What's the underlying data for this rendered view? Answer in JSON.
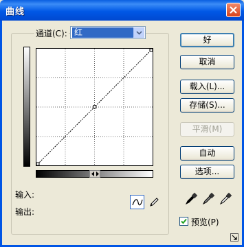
{
  "window": {
    "title": "曲线"
  },
  "channel": {
    "label": "通道(C):",
    "value": "红"
  },
  "curve": {
    "points": [
      [
        0,
        0
      ],
      [
        128,
        128
      ],
      [
        255,
        255
      ]
    ]
  },
  "fields": {
    "input_label": "输入:",
    "output_label": "输出:"
  },
  "buttons": {
    "ok": "好",
    "cancel": "取消",
    "load": "载入(L)...",
    "save": "存储(S)...",
    "smooth": "平滑(M)",
    "auto": "自动",
    "options": "选项..."
  },
  "preview": {
    "label": "预览(P)",
    "checked": true
  },
  "icons": [
    "close-icon",
    "chevron-down-icon",
    "curve-tool-icon",
    "pencil-tool-icon",
    "black-eyedropper-icon",
    "gray-eyedropper-icon",
    "white-eyedropper-icon",
    "resize-icon"
  ]
}
